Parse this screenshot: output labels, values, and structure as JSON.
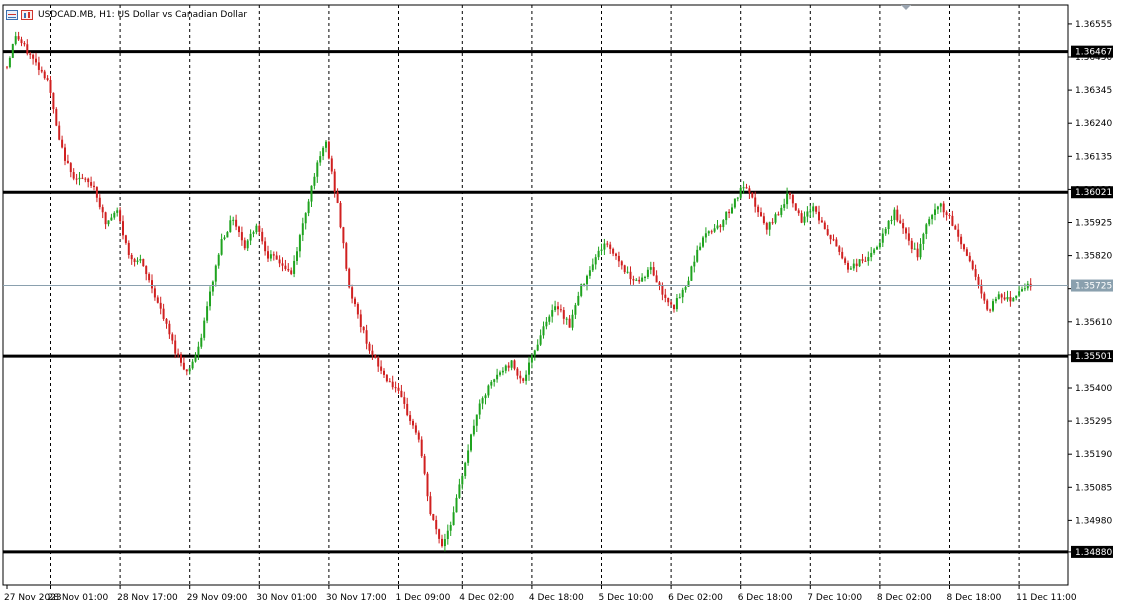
{
  "header": {
    "symbol": "USDCAD.MB",
    "timeframe": "H1:",
    "description": "US Dollar vs Canadian Dollar"
  },
  "chart_data": {
    "type": "candlestick",
    "symbol": "USDCAD.MB",
    "timeframe": "H1",
    "ylim": [
      1.34775,
      1.36615
    ],
    "y_ticks": [
      "1.36555",
      "1.36450",
      "1.36345",
      "1.36240",
      "1.36135",
      "1.36030",
      "1.35925",
      "1.35820",
      "1.35715",
      "1.35610",
      "1.35505",
      "1.35400",
      "1.35295",
      "1.35190",
      "1.35085",
      "1.34980",
      "1.34880"
    ],
    "x_ticks": [
      "27 Nov 2023",
      "28 Nov 01:00",
      "28 Nov 17:00",
      "29 Nov 09:00",
      "30 Nov 01:00",
      "30 Nov 17:00",
      "1 Dec 09:00",
      "4 Dec 02:00",
      "4 Dec 18:00",
      "5 Dec 10:00",
      "6 Dec 02:00",
      "6 Dec 18:00",
      "7 Dec 10:00",
      "8 Dec 02:00",
      "8 Dec 18:00",
      "11 Dec 11:00"
    ],
    "x_tick_bars": [
      0,
      15,
      39,
      63,
      87,
      111,
      135,
      157,
      181,
      205,
      229,
      253,
      277,
      301,
      325,
      349
    ],
    "bar_count": 354,
    "levels": [
      {
        "value": 1.36467,
        "label": "1.36467"
      },
      {
        "value": 1.36021,
        "label": "1.36021"
      },
      {
        "value": 1.35501,
        "label": "1.35501"
      },
      {
        "value": 1.3488,
        "label": "1.34880"
      }
    ],
    "current_price": {
      "value": 1.35725,
      "label": "1.35725"
    },
    "anchors": [
      [
        0,
        1.3642
      ],
      [
        3,
        1.3652
      ],
      [
        6,
        1.3648
      ],
      [
        10,
        1.3643
      ],
      [
        14,
        1.3638
      ],
      [
        18,
        1.3618
      ],
      [
        22,
        1.3608
      ],
      [
        26,
        1.3606
      ],
      [
        30,
        1.3604
      ],
      [
        34,
        1.3592
      ],
      [
        38,
        1.3596
      ],
      [
        42,
        1.3582
      ],
      [
        46,
        1.358
      ],
      [
        50,
        1.3572
      ],
      [
        54,
        1.3562
      ],
      [
        58,
        1.3552
      ],
      [
        62,
        1.3545
      ],
      [
        66,
        1.3552
      ],
      [
        70,
        1.357
      ],
      [
        74,
        1.3587
      ],
      [
        78,
        1.3594
      ],
      [
        82,
        1.3585
      ],
      [
        86,
        1.3592
      ],
      [
        90,
        1.3582
      ],
      [
        94,
        1.358
      ],
      [
        98,
        1.3576
      ],
      [
        102,
        1.3592
      ],
      [
        106,
        1.3608
      ],
      [
        110,
        1.3618
      ],
      [
        114,
        1.3598
      ],
      [
        118,
        1.3572
      ],
      [
        122,
        1.356
      ],
      [
        126,
        1.355
      ],
      [
        130,
        1.3544
      ],
      [
        134,
        1.354
      ],
      [
        138,
        1.3532
      ],
      [
        142,
        1.3524
      ],
      [
        146,
        1.35
      ],
      [
        150,
        1.349
      ],
      [
        154,
        1.35
      ],
      [
        158,
        1.3517
      ],
      [
        162,
        1.3532
      ],
      [
        166,
        1.354
      ],
      [
        170,
        1.3545
      ],
      [
        174,
        1.3548
      ],
      [
        178,
        1.3542
      ],
      [
        182,
        1.3552
      ],
      [
        186,
        1.3562
      ],
      [
        190,
        1.3566
      ],
      [
        194,
        1.356
      ],
      [
        198,
        1.3572
      ],
      [
        202,
        1.358
      ],
      [
        206,
        1.3586
      ],
      [
        210,
        1.3582
      ],
      [
        214,
        1.3576
      ],
      [
        218,
        1.3574
      ],
      [
        222,
        1.3578
      ],
      [
        226,
        1.357
      ],
      [
        230,
        1.3566
      ],
      [
        234,
        1.3572
      ],
      [
        238,
        1.3584
      ],
      [
        242,
        1.359
      ],
      [
        246,
        1.3592
      ],
      [
        250,
        1.3598
      ],
      [
        254,
        1.3604
      ],
      [
        258,
        1.3598
      ],
      [
        262,
        1.359
      ],
      [
        266,
        1.3596
      ],
      [
        270,
        1.3602
      ],
      [
        274,
        1.3592
      ],
      [
        278,
        1.3598
      ],
      [
        282,
        1.359
      ],
      [
        286,
        1.3585
      ],
      [
        290,
        1.3578
      ],
      [
        294,
        1.358
      ],
      [
        298,
        1.3582
      ],
      [
        302,
        1.3588
      ],
      [
        306,
        1.3596
      ],
      [
        310,
        1.3588
      ],
      [
        314,
        1.3582
      ],
      [
        318,
        1.3594
      ],
      [
        322,
        1.3598
      ],
      [
        326,
        1.3592
      ],
      [
        330,
        1.3584
      ],
      [
        334,
        1.3576
      ],
      [
        338,
        1.3564
      ],
      [
        342,
        1.357
      ],
      [
        346,
        1.3568
      ],
      [
        350,
        1.3572
      ],
      [
        353,
        1.3573
      ]
    ]
  }
}
